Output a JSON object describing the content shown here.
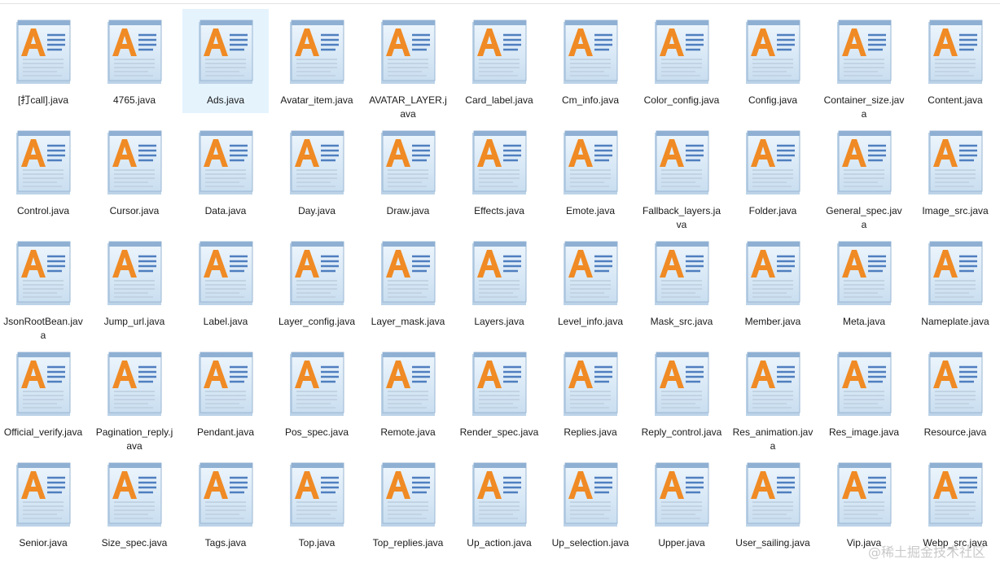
{
  "icon": "wordpad-document-icon",
  "selected_index": 2,
  "colors": {
    "selection": "#e5f3fd",
    "icon_letter": "#f08a24",
    "icon_page": "#dcecf8",
    "icon_lines": "#4f7fbf"
  },
  "files": [
    "[打call].java",
    "4765.java",
    "Ads.java",
    "Avatar_item.java",
    "AVATAR_LAYER.java",
    "Card_label.java",
    "Cm_info.java",
    "Color_config.java",
    "Config.java",
    "Container_size.java",
    "Content.java",
    "Control.java",
    "Cursor.java",
    "Data.java",
    "Day.java",
    "Draw.java",
    "Effects.java",
    "Emote.java",
    "Fallback_layers.java",
    "Folder.java",
    "General_spec.java",
    "Image_src.java",
    "JsonRootBean.java",
    "Jump_url.java",
    "Label.java",
    "Layer_config.java",
    "Layer_mask.java",
    "Layers.java",
    "Level_info.java",
    "Mask_src.java",
    "Member.java",
    "Meta.java",
    "Nameplate.java",
    "Official_verify.java",
    "Pagination_reply.java",
    "Pendant.java",
    "Pos_spec.java",
    "Remote.java",
    "Render_spec.java",
    "Replies.java",
    "Reply_control.java",
    "Res_animation.java",
    "Res_image.java",
    "Resource.java",
    "Senior.java",
    "Size_spec.java",
    "Tags.java",
    "Top.java",
    "Top_replies.java",
    "Up_action.java",
    "Up_selection.java",
    "Upper.java",
    "User_sailing.java",
    "Vip.java",
    "Webp_src.java"
  ],
  "watermark": "@稀土掘金技术社区"
}
